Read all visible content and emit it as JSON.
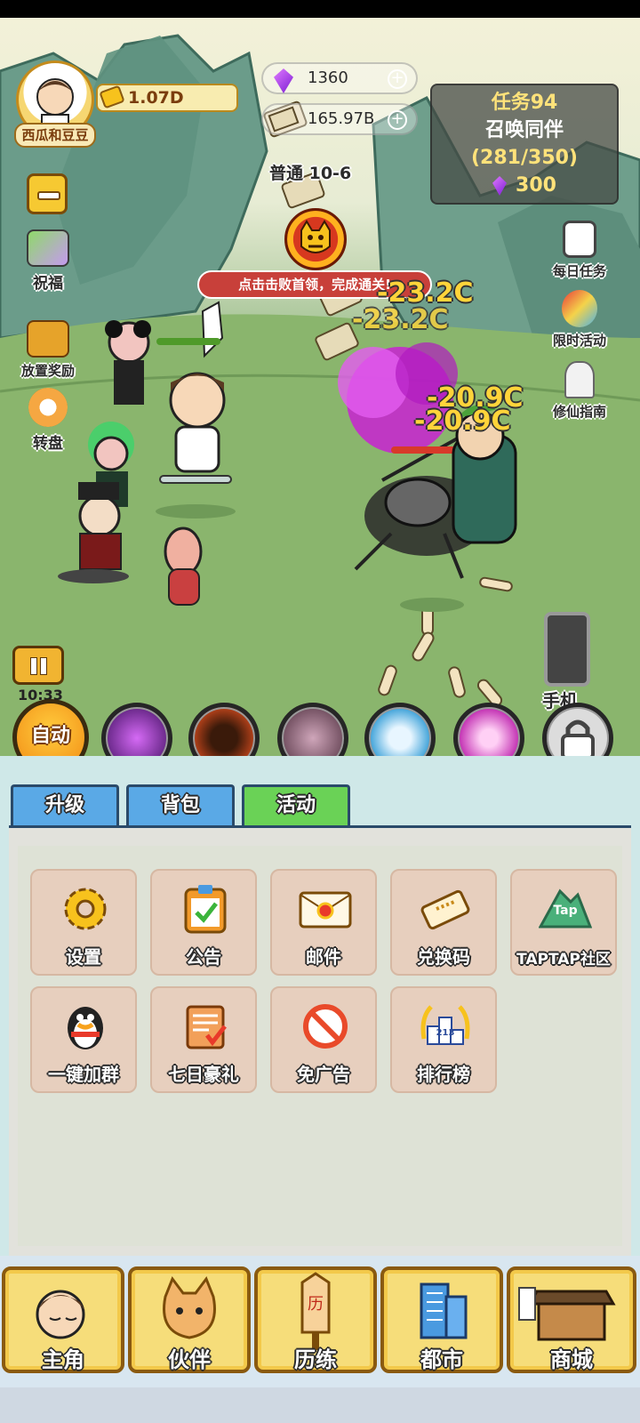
{
  "player": {
    "name": "西瓜和豆豆",
    "gold": "1.07D"
  },
  "resources": {
    "gems": "1360",
    "cash": "165.97B"
  },
  "stage": {
    "label": "普通 10-6",
    "boss_hint": "点击击败首领，完成通关!"
  },
  "quest": {
    "title": "任务94",
    "name": "召唤同伴",
    "progress": "(281/350)",
    "reward": "300"
  },
  "left_menu": [
    {
      "label": "祝福",
      "icon": "blessing-icon"
    },
    {
      "label": "放置奖励",
      "icon": "treasure-chest-icon"
    },
    {
      "label": "转盘",
      "icon": "wheel-icon"
    }
  ],
  "right_menu": [
    {
      "label": "每日任务",
      "icon": "clipboard-icon"
    },
    {
      "label": "限时活动",
      "icon": "party-popper-icon"
    },
    {
      "label": "修仙指南",
      "icon": "immortal-guide-icon"
    }
  ],
  "damage_texts": [
    "-23.2C",
    "-23.2C",
    "-20.9C",
    "-20.9C"
  ],
  "battle_timer": "10:33",
  "phone_label": "手机",
  "auto_label": "自动",
  "skills": [
    {
      "icon": "vortex-skill-icon",
      "color": "#5b1e86"
    },
    {
      "icon": "strongman-skill-icon",
      "color": "#7a3012"
    },
    {
      "icon": "beast-skill-icon",
      "color": "#6a4158"
    },
    {
      "icon": "qilin-skill-icon",
      "color": "#2a7fb0"
    },
    {
      "icon": "pink-vortex-skill-icon",
      "color": "#b42aa6"
    },
    {
      "icon": "lock-icon",
      "color": "#d8d8d8"
    }
  ],
  "tabs": [
    {
      "label": "升级",
      "active": false
    },
    {
      "label": "背包",
      "active": false
    },
    {
      "label": "活动",
      "active": true
    }
  ],
  "activities": [
    {
      "label": "设置",
      "icon": "gear-icon"
    },
    {
      "label": "公告",
      "icon": "notice-board-icon"
    },
    {
      "label": "邮件",
      "icon": "mail-icon"
    },
    {
      "label": "兑换码",
      "icon": "ticket-icon"
    },
    {
      "label": "TAPTAP社区",
      "icon": "taptap-icon",
      "icon_text": "Tap"
    },
    {
      "label": "一键加群",
      "icon": "qq-penguin-icon"
    },
    {
      "label": "七日豪礼",
      "icon": "scroll-check-icon"
    },
    {
      "label": "免广告",
      "icon": "no-ads-icon"
    },
    {
      "label": "排行榜",
      "icon": "ranking-podium-icon",
      "icon_text": "213"
    }
  ],
  "bottom_nav": [
    {
      "label": "主角",
      "icon": "hero-portrait-icon"
    },
    {
      "label": "伙伴",
      "icon": "cat-partner-icon"
    },
    {
      "label": "历练",
      "icon": "training-sign-icon",
      "icon_text": "历"
    },
    {
      "label": "都市",
      "icon": "city-building-icon"
    },
    {
      "label": "商城",
      "icon": "shop-stall-icon"
    }
  ]
}
